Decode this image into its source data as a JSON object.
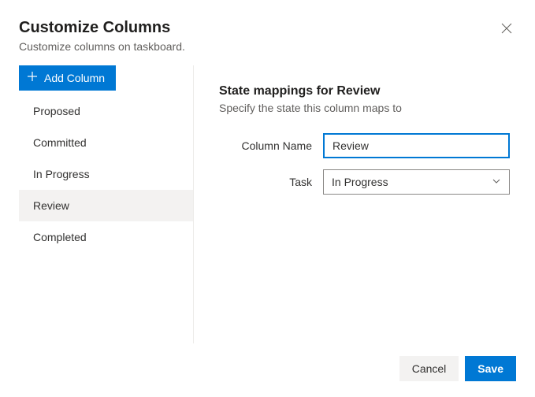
{
  "header": {
    "title": "Customize Columns",
    "subtitle": "Customize columns on taskboard."
  },
  "sidebar": {
    "add_label": "Add Column",
    "items": [
      {
        "label": "Proposed"
      },
      {
        "label": "Committed"
      },
      {
        "label": "In Progress"
      },
      {
        "label": "Review"
      },
      {
        "label": "Completed"
      }
    ],
    "selected_index": 3
  },
  "main": {
    "section_title": "State mappings for Review",
    "section_desc": "Specify the state this column maps to",
    "column_name_label": "Column Name",
    "column_name_value": "Review",
    "task_label": "Task",
    "task_value": "In Progress"
  },
  "footer": {
    "cancel": "Cancel",
    "save": "Save"
  }
}
